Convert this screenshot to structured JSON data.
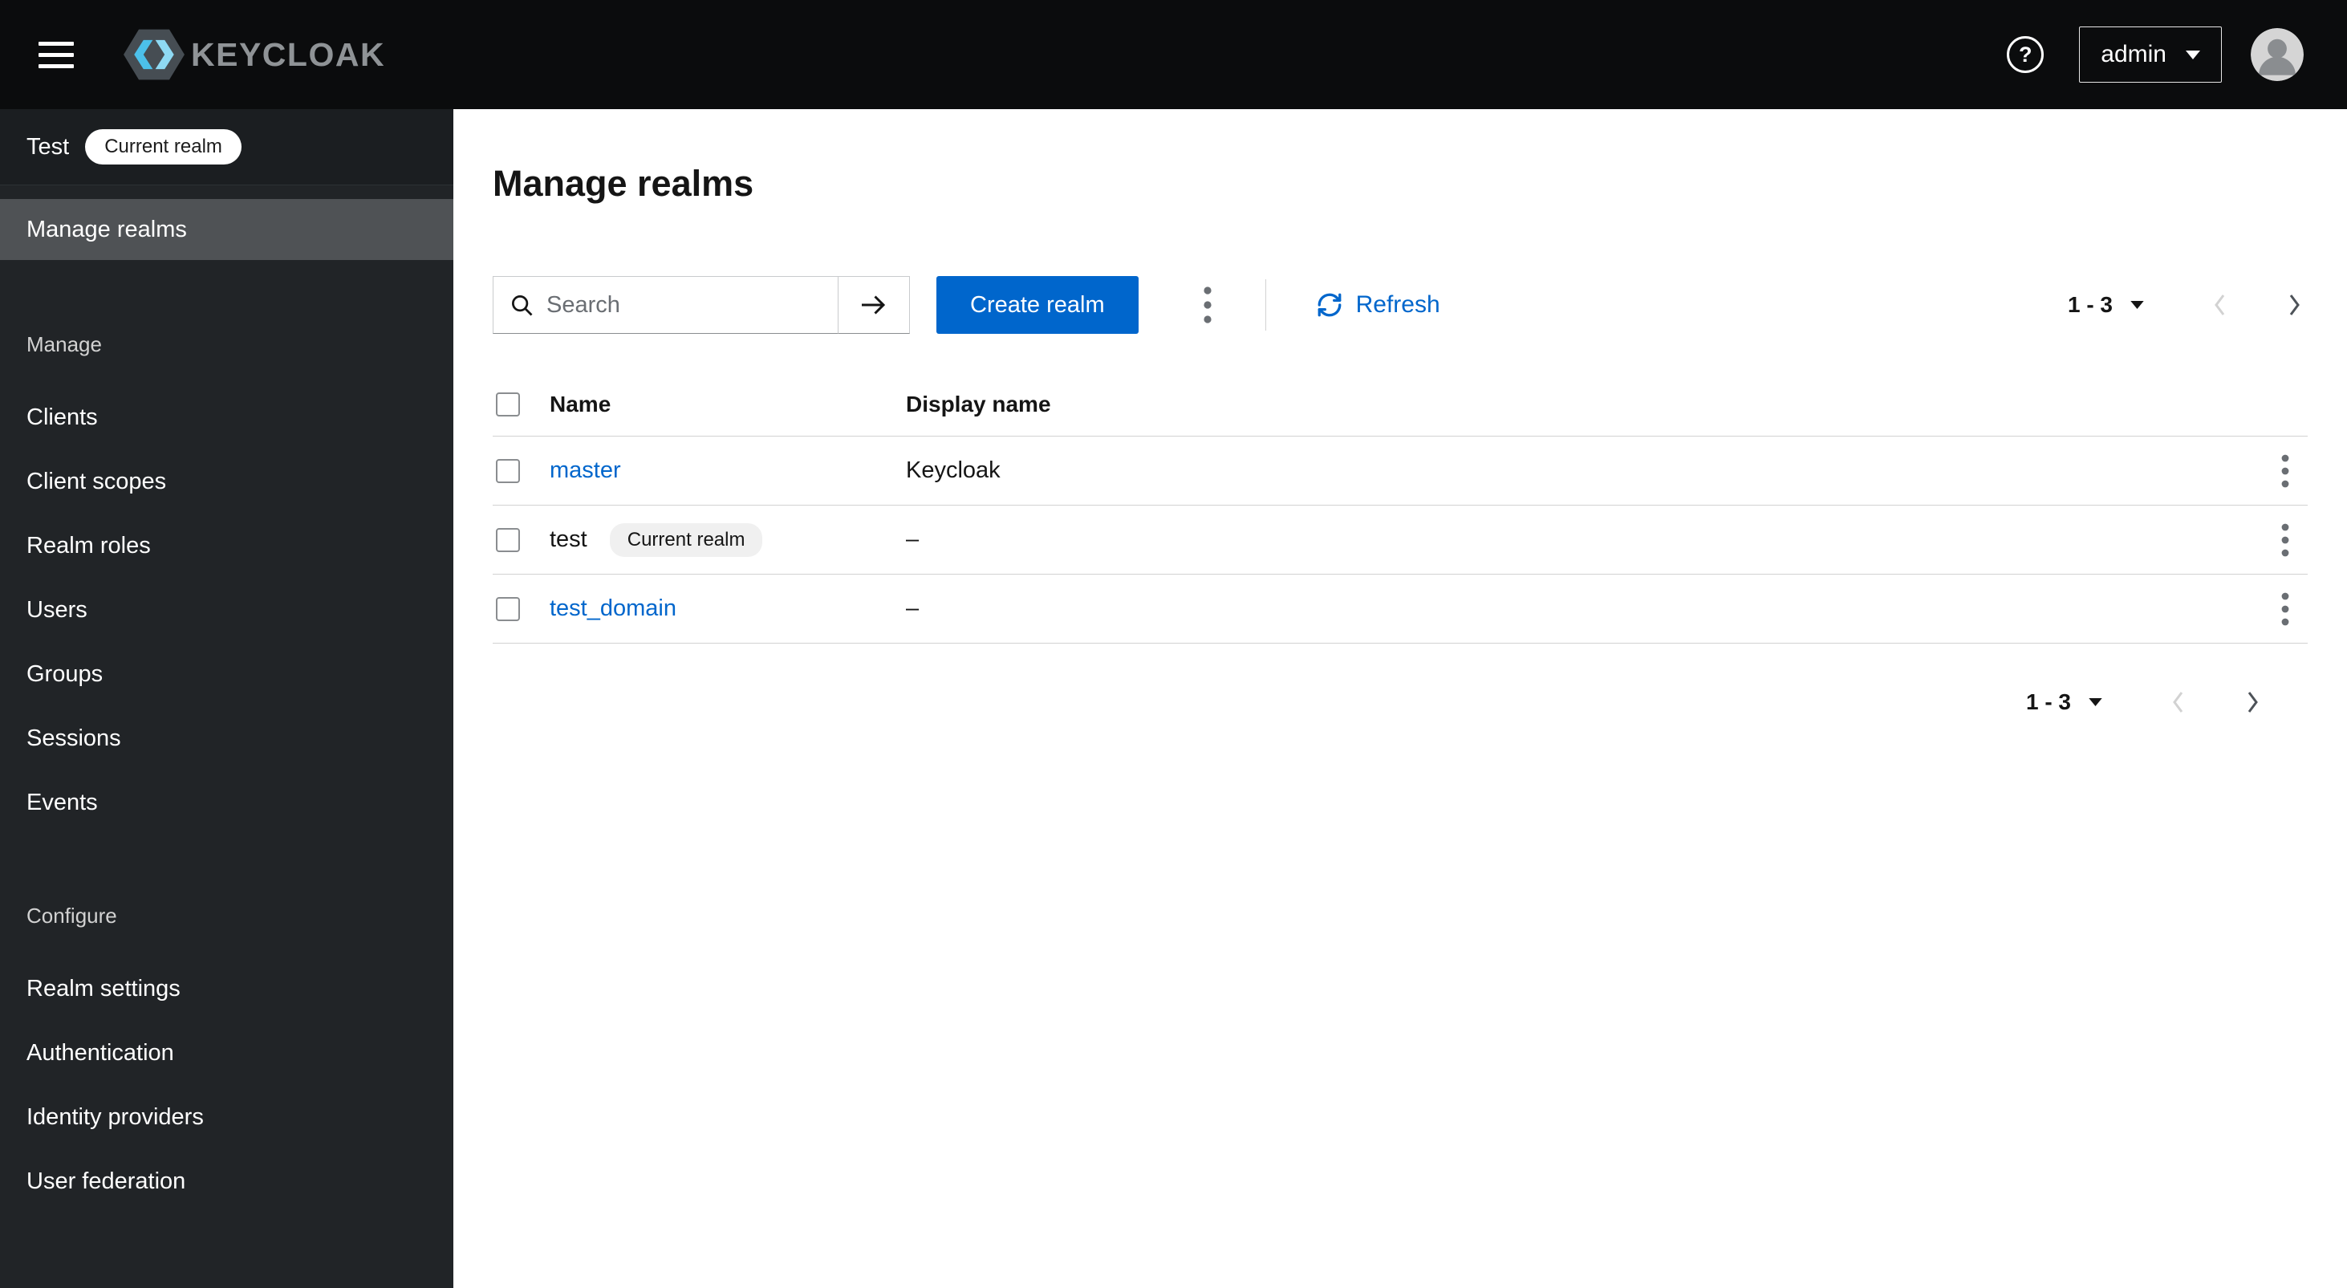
{
  "colors": {
    "primary": "#0066cc",
    "link": "#0066cc",
    "masthead_bg": "#0b0c0d",
    "sidebar_bg": "#212427",
    "selected_nav_bg": "#4f5255"
  },
  "header": {
    "brand": "KEYCLOAK",
    "help_icon": "?",
    "user_menu_label": "admin"
  },
  "sidebar": {
    "realm_name": "Test",
    "realm_badge": "Current realm",
    "manage_realms_item": "Manage realms",
    "manage_label": "Manage",
    "manage_items": [
      "Clients",
      "Client scopes",
      "Realm roles",
      "Users",
      "Groups",
      "Sessions",
      "Events"
    ],
    "configure_label": "Configure",
    "configure_items": [
      "Realm settings",
      "Authentication",
      "Identity providers",
      "User federation"
    ]
  },
  "main": {
    "title": "Manage realms",
    "toolbar": {
      "search_placeholder": "Search",
      "create_realm_button": "Create realm",
      "refresh_label": "Refresh",
      "pagination_range": "1 - 3"
    },
    "table": {
      "columns": [
        "Name",
        "Display name"
      ],
      "rows": [
        {
          "name": "master",
          "display_name": "Keycloak"
        },
        {
          "name": "test",
          "badge": "Current realm",
          "display_name": "–"
        },
        {
          "name": "test_domain",
          "display_name": "–"
        }
      ]
    },
    "pagination_bottom_range": "1 - 3"
  }
}
